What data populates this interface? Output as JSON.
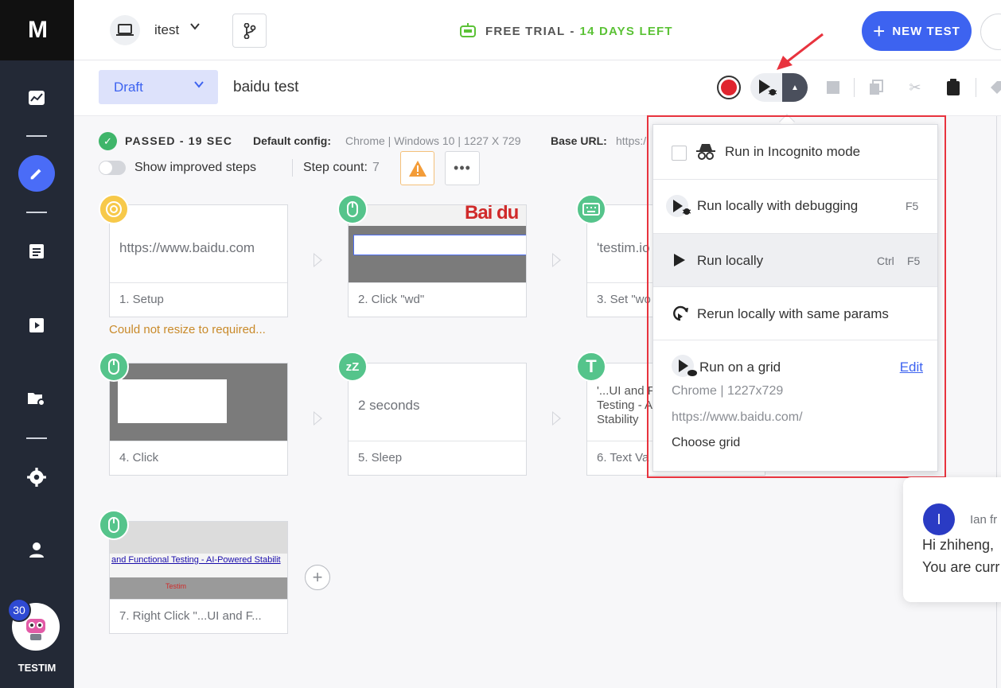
{
  "app": {
    "logo": "M",
    "brand": "TESTIM",
    "notification_count": "30"
  },
  "header": {
    "project": "itest",
    "trial_label": "FREE TRIAL",
    "trial_dash": "-",
    "trial_days": "14 DAYS LEFT",
    "new_test": "NEW TEST"
  },
  "test": {
    "status": "Draft",
    "name": "baidu test",
    "result": "PASSED - 19 SEC",
    "config_label": "Default config:",
    "config_value": "Chrome | Windows 10 | 1227 X 729",
    "base_url_label": "Base URL:",
    "base_url_value": "https:/",
    "show_improved": "Show improved steps",
    "step_count_label": "Step count:",
    "step_count": "7"
  },
  "steps": [
    {
      "label": "1. Setup",
      "preview": "https://www.baidu.com",
      "icon": "chrome-icon"
    },
    {
      "label": "2. Click \"wd\"",
      "preview": "Bai du",
      "icon": "mouse-icon"
    },
    {
      "label": "3. Set \"wo",
      "preview": "'testim.io",
      "icon": "keyboard-icon"
    },
    {
      "label": "4. Click",
      "icon": "mouse-icon"
    },
    {
      "label": "5. Sleep",
      "preview": "2 seconds",
      "icon": "sleep-icon"
    },
    {
      "label": "6. Text Va",
      "preview_lines": [
        "'...UI and F",
        "Testing - A",
        "Stability"
      ],
      "icon": "text-icon"
    },
    {
      "label": "7. Right Click \"...UI and F...",
      "preview_link": "and Functional Testing - AI-Powered Stabilit",
      "preview_extra": "Testim",
      "icon": "mouse-icon"
    }
  ],
  "resize_warning": "Could not resize to required...",
  "dropdown": {
    "incognito": "Run in Incognito mode",
    "debug": "Run locally with debugging",
    "debug_shortcut": "F5",
    "local": "Run locally",
    "local_shortcut_mod": "Ctrl",
    "local_shortcut_key": "F5",
    "rerun": "Rerun locally with same params",
    "grid": "Run on a grid",
    "grid_edit": "Edit",
    "grid_browser": "Chrome | 1227x729",
    "grid_url": "https://www.baidu.com/",
    "grid_choose": "Choose grid"
  },
  "chat": {
    "avatar": "I",
    "from": "Ian fr",
    "line1": "Hi zhiheng,",
    "line2": "You are curr"
  },
  "colors": {
    "accent": "#3d63f0",
    "sidebar": "#232936",
    "passed": "#3fb56a",
    "trial": "#5bc236",
    "highlight": "#e8333e"
  }
}
